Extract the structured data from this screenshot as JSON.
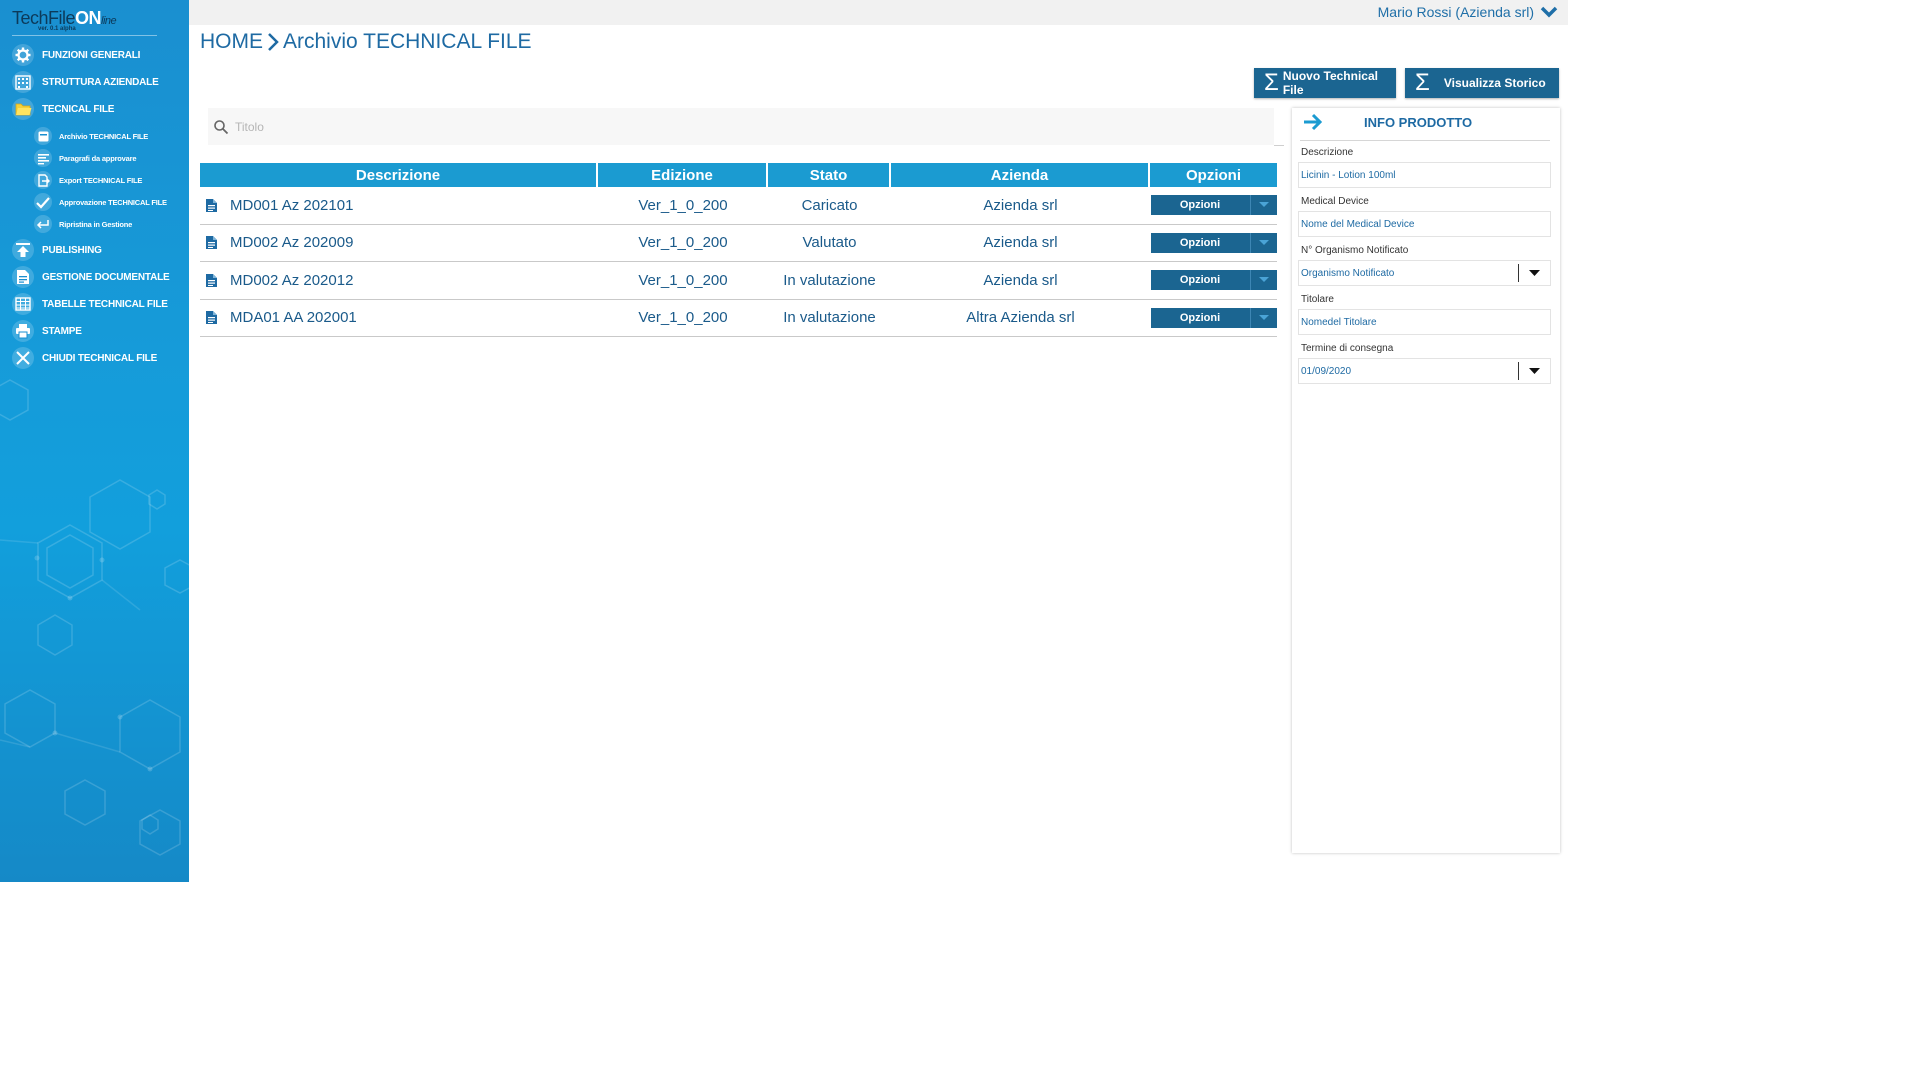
{
  "app": {
    "logo_tech": "TechFile",
    "logo_on": "ON",
    "logo_line": "line",
    "version": "ver. 0.1 alpha"
  },
  "sidebar": {
    "items": [
      {
        "label": "FUNZIONI GENERALI",
        "icon": "gear-icon"
      },
      {
        "label": "STRUTTURA AZIENDALE",
        "icon": "building-icon"
      },
      {
        "label": "TECNICAL FILE",
        "icon": "folder-icon"
      },
      {
        "label": "PUBLISHING",
        "icon": "upload-icon"
      },
      {
        "label": "GESTIONE DOCUMENTALE",
        "icon": "document-icon"
      },
      {
        "label": "TABELLE TECHNICAL FILE",
        "icon": "table-icon"
      },
      {
        "label": "STAMPE",
        "icon": "printer-icon"
      },
      {
        "label": "CHIUDI TECHNICAL FILE",
        "icon": "close-icon"
      }
    ],
    "subitems": [
      {
        "label": "Archivio TECHNICAL FILE",
        "icon": "archive-icon"
      },
      {
        "label": "Paragrafi da approvare",
        "icon": "list-icon"
      },
      {
        "label": "Export TECHNICAL FILE",
        "icon": "export-icon"
      },
      {
        "label": "Approvazione TECHNICAL FILE",
        "icon": "check-icon"
      },
      {
        "label": "Ripristina in Gestione",
        "icon": "return-icon"
      }
    ]
  },
  "topbar": {
    "user": "Mario Rossi (Azienda srl)"
  },
  "breadcrumb": {
    "home": "HOME",
    "current": "Archivio TECHNICAL FILE"
  },
  "actions": {
    "new_label": "Nuovo Technical File",
    "history_label": "Visualizza Storico"
  },
  "search": {
    "placeholder": "Titolo"
  },
  "table": {
    "headers": [
      "Descrizione",
      "Edizione",
      "Stato",
      "Azienda",
      "Opzioni"
    ],
    "rows": [
      {
        "descrizione": "MD001 Az 202101",
        "edizione": "Ver_1_0_200",
        "stato": "Caricato",
        "azienda": "Azienda srl",
        "opzioni": "Opzioni"
      },
      {
        "descrizione": "MD002 Az 202009",
        "edizione": "Ver_1_0_200",
        "stato": "Valutato",
        "azienda": "Azienda srl",
        "opzioni": "Opzioni"
      },
      {
        "descrizione": "MD002 Az 202012",
        "edizione": "Ver_1_0_200",
        "stato": "In valutazione",
        "azienda": "Azienda srl",
        "opzioni": "Opzioni"
      },
      {
        "descrizione": "MDA01 AA 202001",
        "edizione": "Ver_1_0_200",
        "stato": "In valutazione",
        "azienda": "Altra Azienda srl",
        "opzioni": "Opzioni"
      }
    ]
  },
  "panel": {
    "title": "INFO PRODOTTO",
    "fields": [
      {
        "label": "Descrizione",
        "value": "Licinin - Lotion 100ml"
      },
      {
        "label": "Medical Device",
        "value": "Nome del Medical Device"
      },
      {
        "label": "N° Organismo Notificato",
        "value": "Organismo Notificato"
      },
      {
        "label": "Titolare",
        "value": "Nomedel Titolare"
      },
      {
        "label": "Termine di consegna",
        "value": "01/09/2020"
      }
    ]
  },
  "colors": {
    "accent": "#1b9bd1",
    "button": "#1b6591",
    "text": "#1e6aa3"
  }
}
